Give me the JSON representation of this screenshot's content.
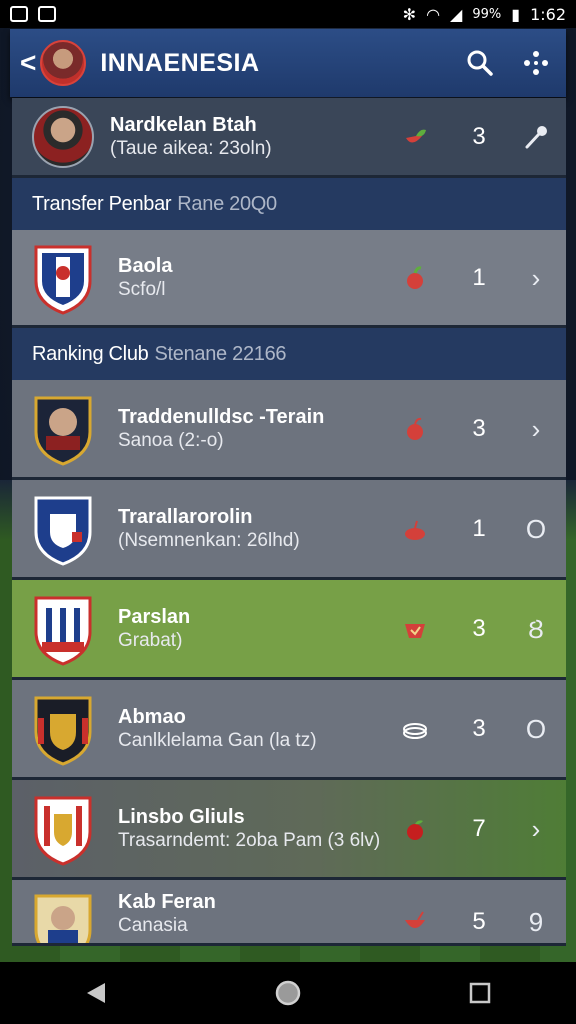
{
  "status_bar": {
    "battery": "99%",
    "time": "1:62"
  },
  "app_bar": {
    "title": "INNAENESIA"
  },
  "player_row": {
    "name": "Nardkelan Btah",
    "sub": "(Taue aikea: 23oln)",
    "count": "3"
  },
  "sections": [
    {
      "title": "Transfer Penbar",
      "subtitle": "Rane 20Q0"
    },
    {
      "title": "Ranking Club",
      "subtitle": "Stenane 22166"
    }
  ],
  "transfer_rows": [
    {
      "name": "Baola",
      "sub": "Scfo/l",
      "count": "1",
      "trail": "›"
    }
  ],
  "ranking_rows": [
    {
      "name": "Traddenulldsc -Terain",
      "sub": "Sanoa (2:-o)",
      "count": "3",
      "trail": "›"
    },
    {
      "name": "Trarallarorolin",
      "sub": "(Nsemnenkan: 26lhd)",
      "count": "1",
      "trail": "O"
    },
    {
      "name": "Parslan",
      "sub": "Grabat)",
      "count": "3",
      "trail": "Ȣ"
    },
    {
      "name": "Abmao",
      "sub": "Canlklelama Gan (la tz)",
      "count": "3",
      "trail": "O"
    },
    {
      "name": "Linsbo Gliuls",
      "sub": "Trasarndemt: 2oba Pam (3 6lv)",
      "count": "7",
      "trail": "›"
    },
    {
      "name": "Kab Feran",
      "sub": "Canasia",
      "count": "5",
      "trail": "9"
    }
  ],
  "colors": {
    "app_bar": "#2c4d86",
    "section": "#253a61",
    "highlight_row": "#77a047",
    "accent_red": "#d4403a"
  }
}
